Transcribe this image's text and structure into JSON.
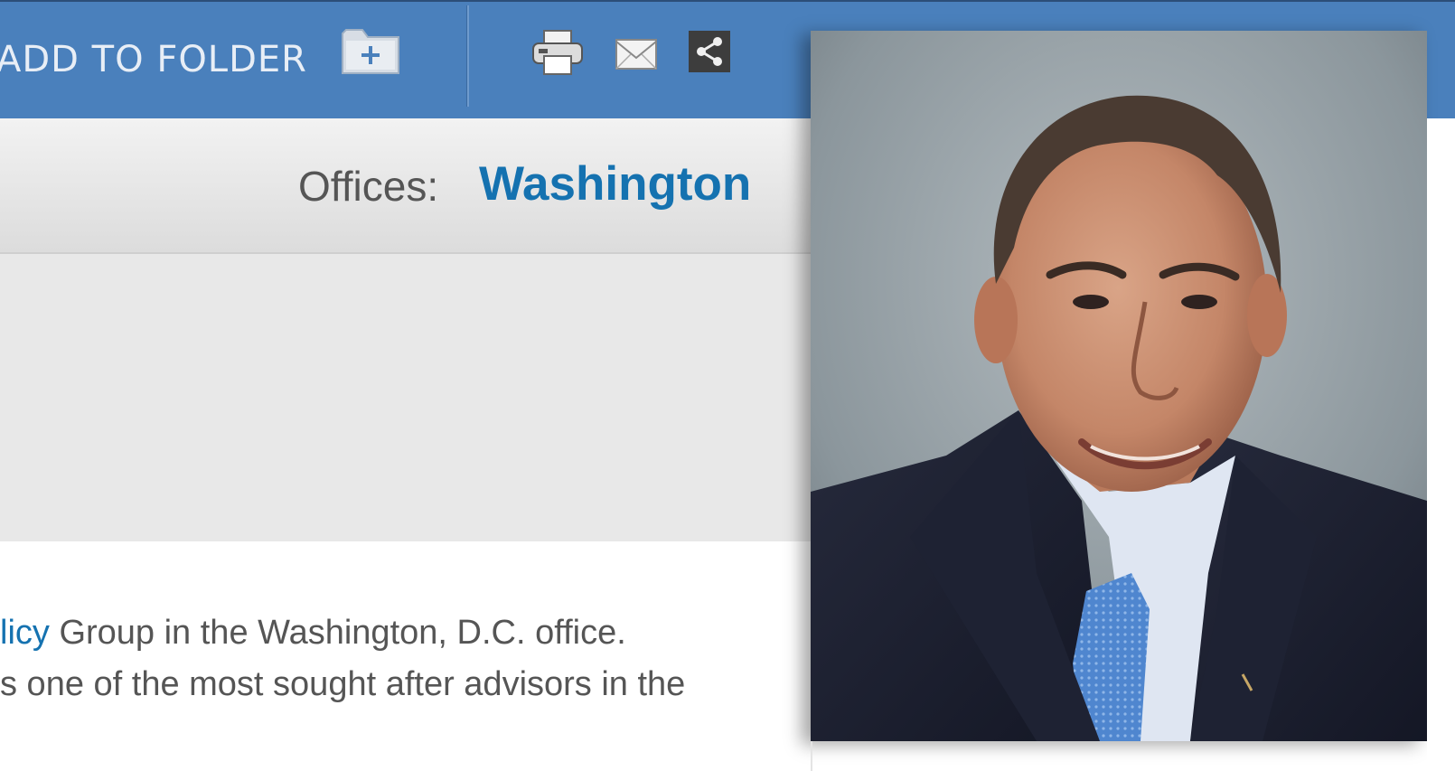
{
  "toolbar": {
    "add_to_folder_label": "ADD TO FOLDER",
    "icons": {
      "folder": "add-folder-icon",
      "print": "printer-icon",
      "mail": "email-icon",
      "share": "share-icon"
    },
    "colors": {
      "background": "#4a80bc",
      "text": "#e8eef6"
    }
  },
  "offices": {
    "label": "Offices:",
    "value": "Washington",
    "value_color": "#1572b0"
  },
  "bio": {
    "line1_link": "licy",
    "line1_rest": " Group in the Washington, D.C. office.",
    "line2": "s one of the most sought after advisors in the"
  }
}
